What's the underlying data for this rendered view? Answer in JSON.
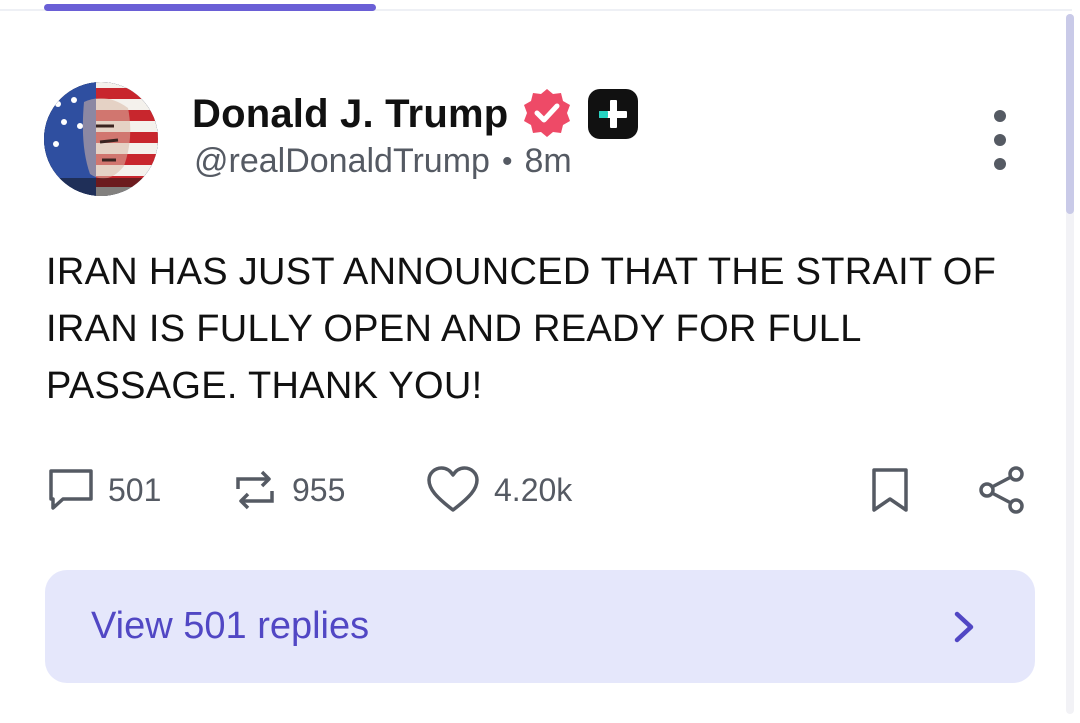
{
  "post": {
    "display_name": "Donald J. Trump",
    "handle": "@realDonaldTrump",
    "separator": "•",
    "time_ago": "8m",
    "text": "IRAN HAS JUST ANNOUNCED THAT THE STRAIT OF IRAN IS FULLY OPEN AND READY FOR FULL PASSAGE. THANK YOU!"
  },
  "actions": {
    "comments": "501",
    "reposts": "955",
    "likes": "4.20k"
  },
  "replies_button": {
    "label": "View 501 replies"
  },
  "icons": {
    "verified": "verified-badge-icon",
    "plus_badge": "plus-badge-icon",
    "more": "more-vertical-icon",
    "comment": "comment-icon",
    "repost": "repost-icon",
    "like": "heart-icon",
    "bookmark": "bookmark-icon",
    "share": "share-icon",
    "chevron": "chevron-right-icon"
  },
  "colors": {
    "accent": "#6a5fd6",
    "replies_bg": "#e5e7fb",
    "replies_text": "#5147c4",
    "verified": "#ee4a67",
    "muted": "#555a63"
  }
}
